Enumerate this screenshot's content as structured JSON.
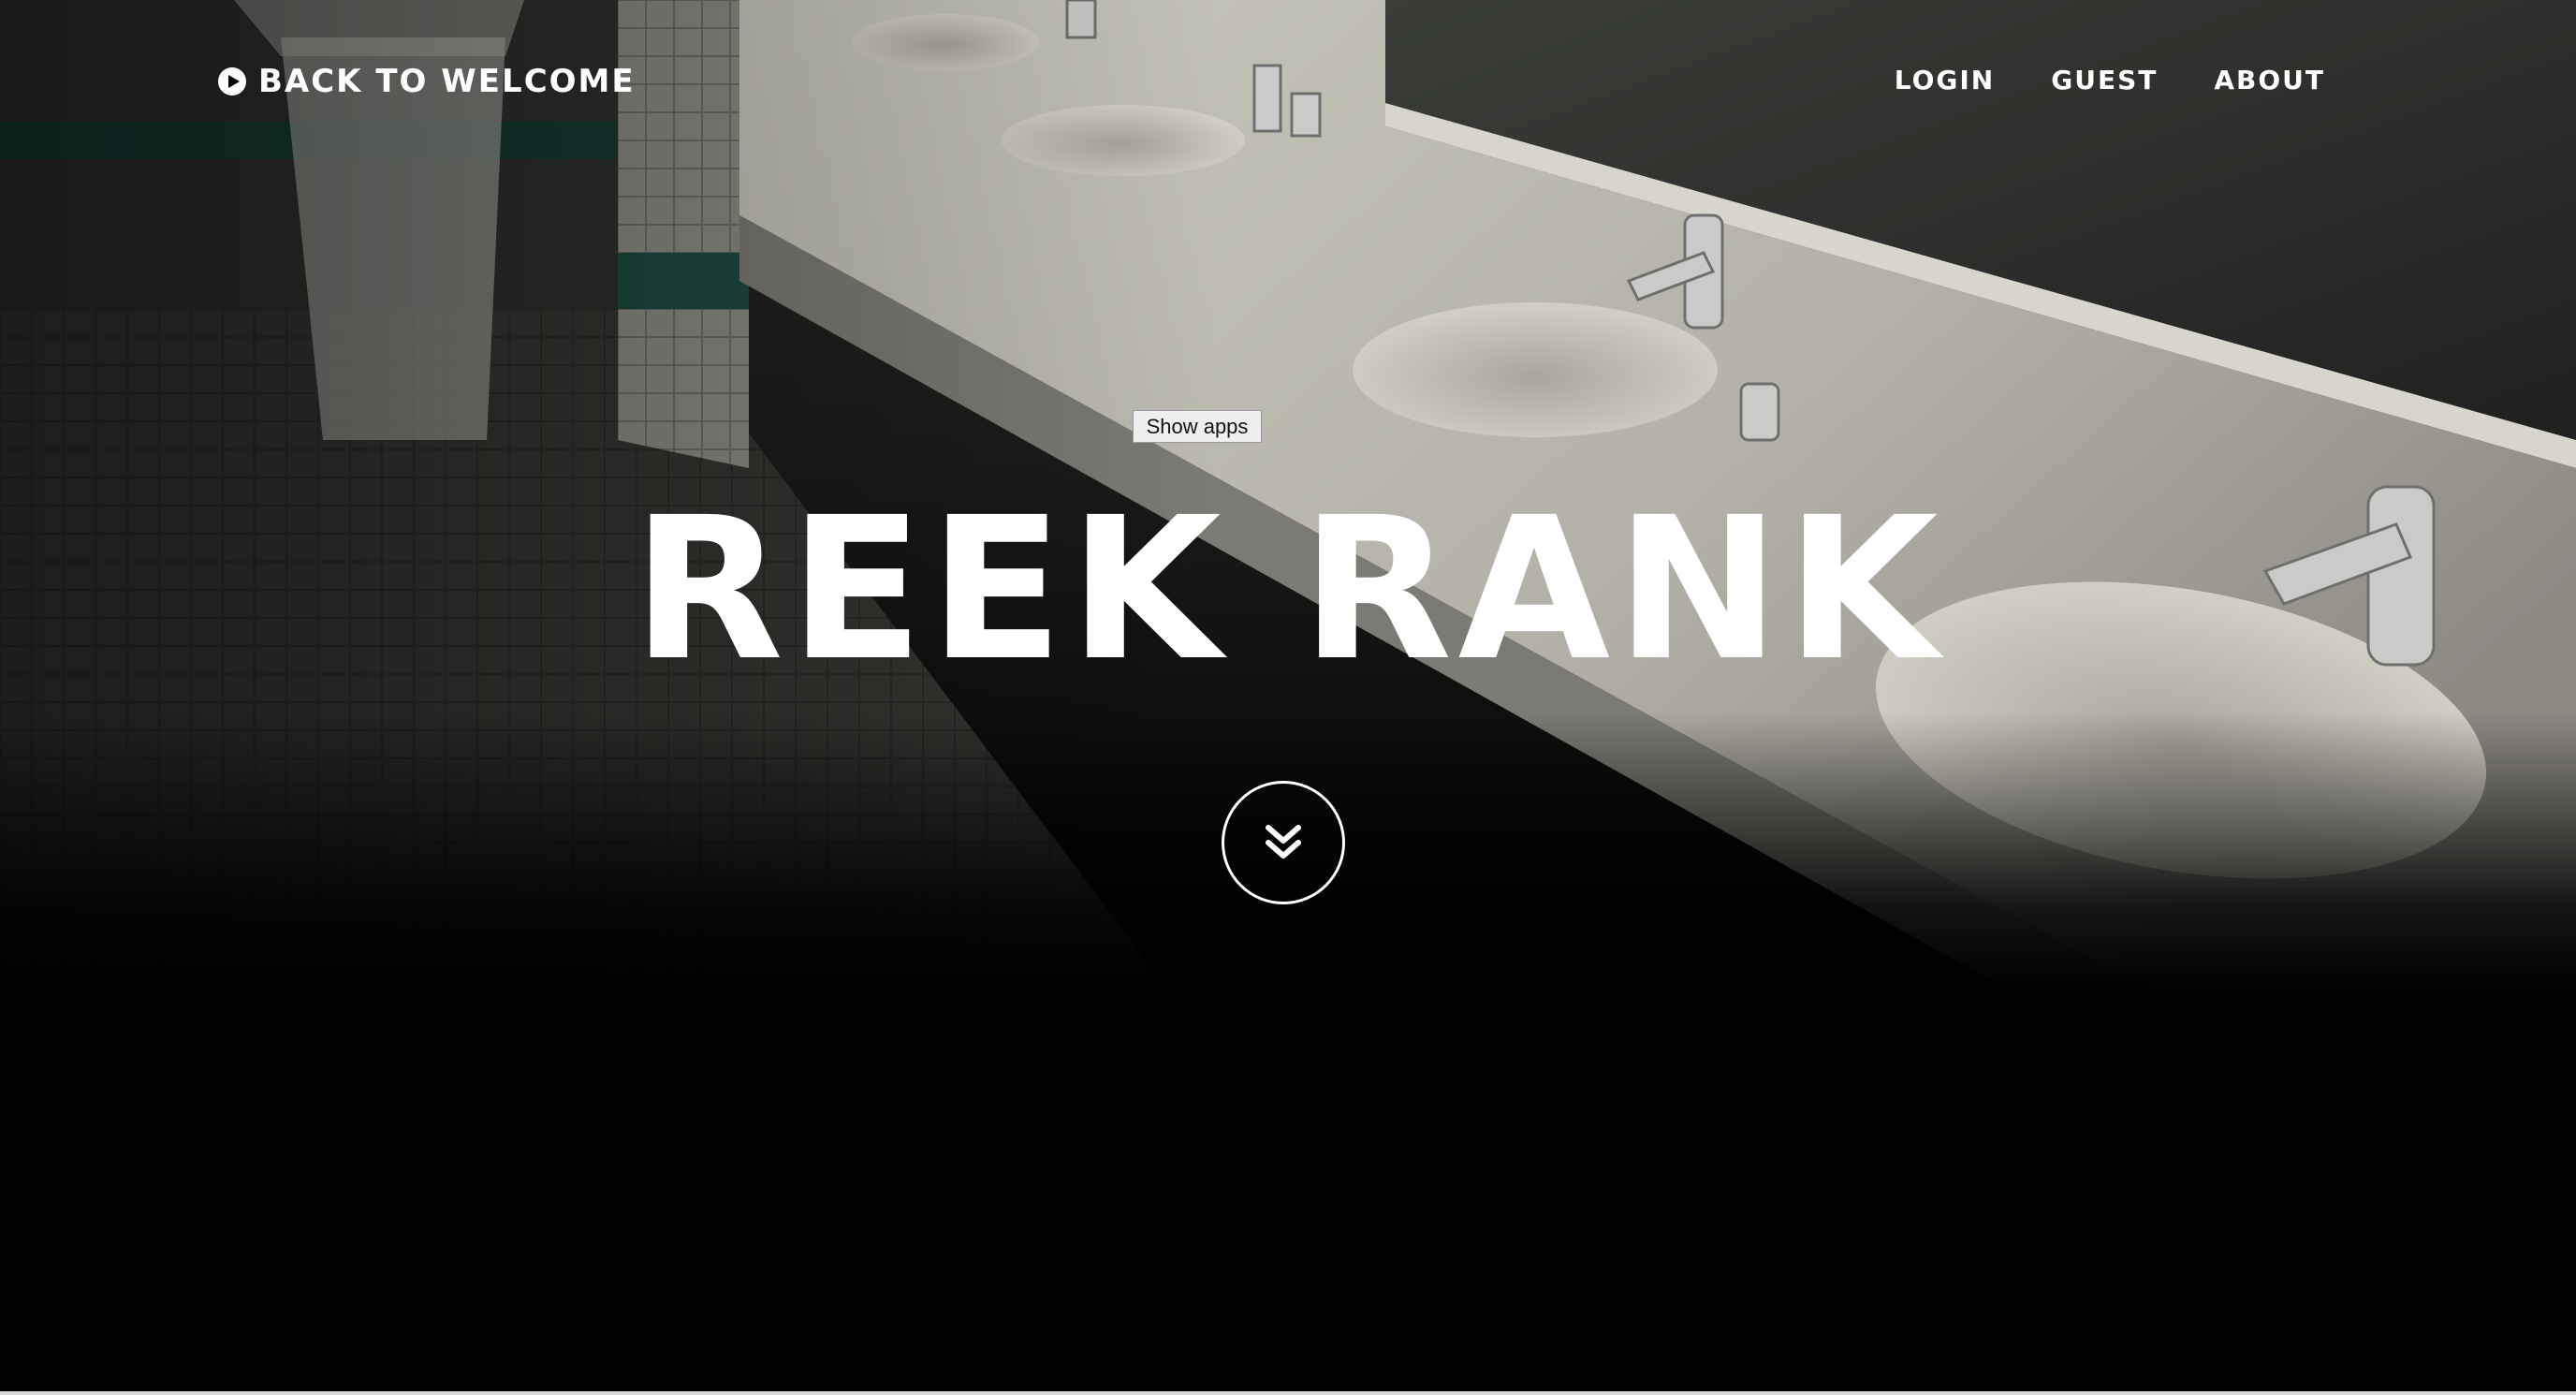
{
  "nav": {
    "back_label": "BACK TO WELCOME",
    "back_icon": "play-circle-icon",
    "links": [
      {
        "label": "LOGIN"
      },
      {
        "label": "GUEST"
      },
      {
        "label": "ABOUT"
      }
    ]
  },
  "overlay": {
    "show_apps_label": "Show apps"
  },
  "hero": {
    "title": "REEK RANK",
    "background_image": "restroom sinks row photo",
    "scroll_icon": "double-chevron-down-icon"
  },
  "colors": {
    "text": "#ffffff",
    "page_background": "#000000",
    "button_background": "#efefef"
  }
}
